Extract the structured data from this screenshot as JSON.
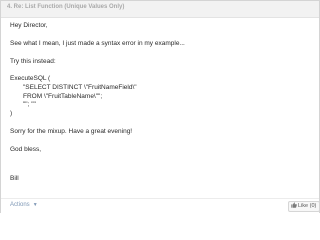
{
  "post": {
    "title": "4. Re: List Function (Unique Values Only)"
  },
  "body": {
    "greeting": "Hey Director,",
    "line1": "See what I mean, I just made a syntax error in my example...",
    "line2": "Try this instead:",
    "code_start": "ExecuteSQL (",
    "code_select": "\"SELECT DISTINCT \\\"FruitNameField\\\"",
    "code_from": "FROM \\\"FruitTableName\\\"\";",
    "code_args": "\"\"; \"\"",
    "code_end": ")",
    "closing": "Sorry for the mixup. Have a great evening!",
    "blessing": "God bless,",
    "signature": "Bill"
  },
  "footer": {
    "actions_label": "Actions",
    "like_label": "Like (0)"
  },
  "colors": {
    "header_bg": "#f2f2f2",
    "title": "#a9a9a9",
    "text": "#2a2a2a",
    "link": "#7f98b6"
  },
  "icons": {
    "actions_caret": "chevron-down-icon",
    "like": "thumbs-up-icon"
  }
}
